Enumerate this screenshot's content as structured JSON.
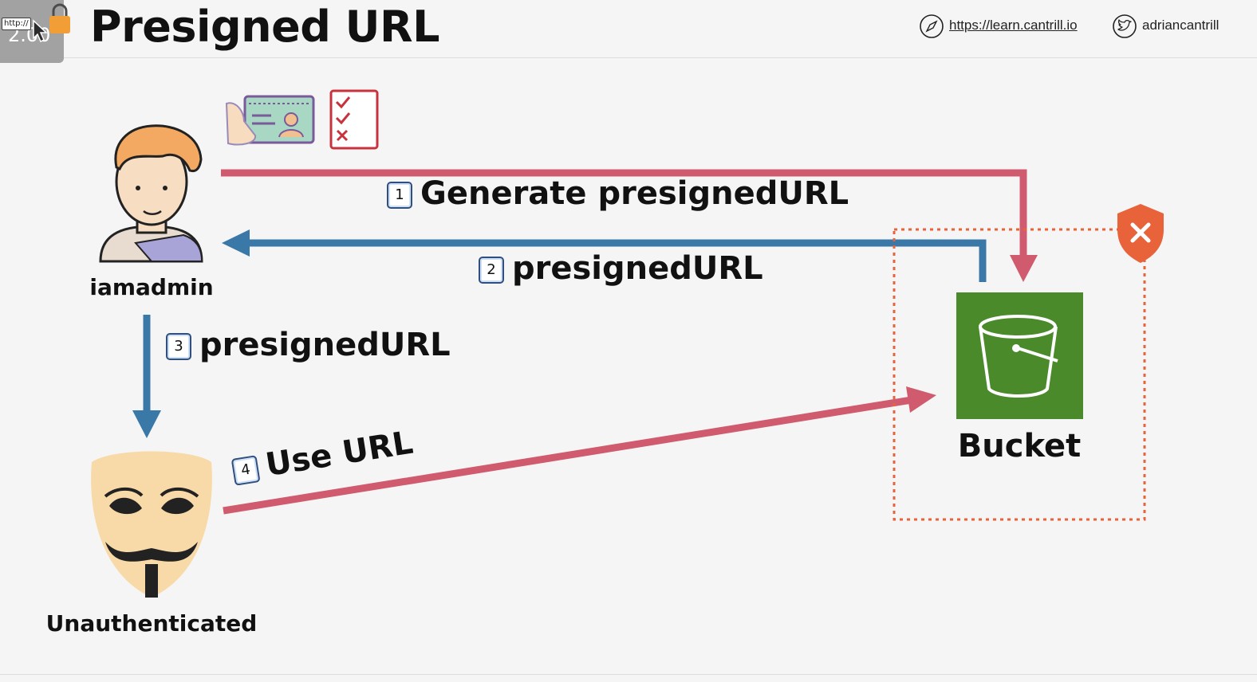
{
  "header": {
    "title": "Presigned URL",
    "zoom": "2.00",
    "http_tag": "http://",
    "website": "https://learn.cantrill.io",
    "twitter": "adriancantrill"
  },
  "actors": {
    "admin": "iamadmin",
    "anon": "Unauthenticated",
    "bucket": "Bucket"
  },
  "steps": [
    {
      "num": "1",
      "label": "Generate presignedURL"
    },
    {
      "num": "2",
      "label": "presignedURL"
    },
    {
      "num": "3",
      "label": "presignedURL"
    },
    {
      "num": "4",
      "label": "Use URL"
    }
  ],
  "colors": {
    "red_arrow": "#d05a6e",
    "blue_arrow": "#3a78a8",
    "bucket_green": "#4a8a2a",
    "boundary_orange": "#e8623a"
  },
  "icons": [
    "safari-compass-icon",
    "twitter-bird-icon",
    "id-card-icon",
    "checklist-icon",
    "shield-deny-icon",
    "bucket-icon",
    "admin-avatar-icon",
    "anonymous-mask-icon",
    "cursor-icon",
    "lock-icon"
  ]
}
